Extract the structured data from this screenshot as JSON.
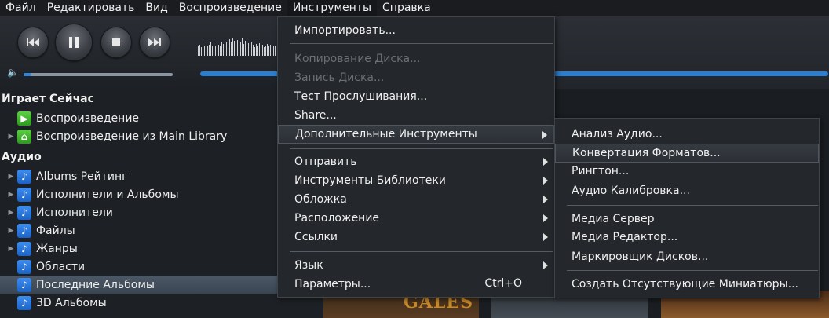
{
  "menubar": {
    "items": [
      "Файл",
      "Редактировать",
      "Вид",
      "Воспроизведение",
      "Инструменты",
      "Справка"
    ]
  },
  "player": {
    "buttons": [
      "skip-back",
      "pause",
      "stop",
      "skip-forward"
    ],
    "volume_level": 0.05,
    "accent": "#2b7ed0"
  },
  "sidebar": {
    "now_playing_header": "Играет Сейчас",
    "now_playing": [
      {
        "label": "Воспроизведение",
        "icon": "play-icon"
      },
      {
        "label": "Воспроизведение из Main Library",
        "icon": "home-play-icon"
      }
    ],
    "audio_header": "Аудио",
    "audio": [
      {
        "label": "Albums Рейтинг",
        "icon": "note-icon"
      },
      {
        "label": "Исполнители и Альбомы",
        "icon": "note-icon"
      },
      {
        "label": "Исполнители",
        "icon": "note-icon"
      },
      {
        "label": "Файлы",
        "icon": "note-icon"
      },
      {
        "label": "Жанры",
        "icon": "note-icon"
      },
      {
        "label": "Области",
        "icon": "note-icon"
      },
      {
        "label": "Последние Альбомы",
        "icon": "note-icon",
        "selected": true
      },
      {
        "label": "3D Альбомы",
        "icon": "note-icon"
      }
    ]
  },
  "tools_menu": {
    "items": [
      {
        "label": "Импортировать..."
      },
      {
        "label": "Копирование Диска...",
        "disabled": true
      },
      {
        "label": "Запись Диска...",
        "disabled": true
      },
      {
        "label": "Тест Прослушивания..."
      },
      {
        "label": "Share..."
      },
      {
        "label": "Дополнительные Инструменты",
        "submenu": true,
        "highlighted": true
      },
      {
        "label": "Отправить",
        "submenu": true
      },
      {
        "label": "Инструменты Библиотеки",
        "submenu": true
      },
      {
        "label": "Обложка",
        "submenu": true
      },
      {
        "label": "Расположение",
        "submenu": true
      },
      {
        "label": "Ссылки",
        "submenu": true
      },
      {
        "label": "Язык",
        "submenu": true
      },
      {
        "label": "Параметры...",
        "shortcut": "Ctrl+O"
      }
    ]
  },
  "extra_tools_menu": {
    "items": [
      {
        "label": "Анализ Аудио..."
      },
      {
        "label": "Конвертация Форматов...",
        "highlighted": true
      },
      {
        "label": "Рингтон..."
      },
      {
        "label": "Аудио Калибровка..."
      },
      {
        "label": "Медиа Сервер"
      },
      {
        "label": "Медиа Редактор..."
      },
      {
        "label": "Маркировщик Дисков..."
      },
      {
        "label": "Создать Отсутствующие Миниатюры..."
      }
    ]
  },
  "content": {
    "album_text": "GALES"
  }
}
